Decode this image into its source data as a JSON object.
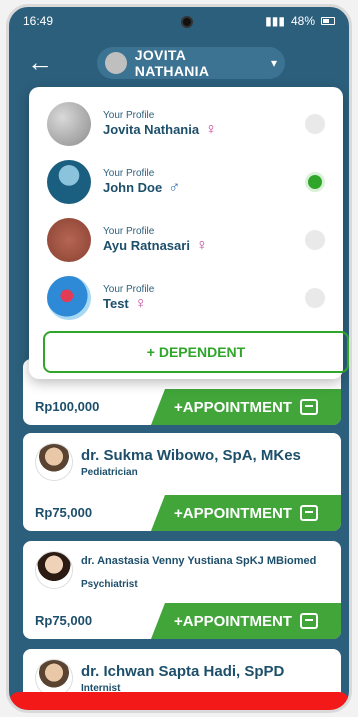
{
  "status": {
    "time": "16:49",
    "battery": "48%"
  },
  "header": {
    "selected_profile": "JOVITA NATHANIA",
    "icons": {
      "back": "arrow-left-icon",
      "caret": "chevron-down-icon"
    }
  },
  "dropdown": {
    "options": [
      {
        "caption": "Your Profile",
        "name": "Jovita Nathania",
        "gender": "♀",
        "selected": false
      },
      {
        "caption": "Your Profile",
        "name": "John Doe",
        "gender": "♂",
        "selected": true
      },
      {
        "caption": "Your Profile",
        "name": "Ayu Ratnasari",
        "gender": "♀",
        "selected": false
      },
      {
        "caption": "Your Profile",
        "name": "Test",
        "gender": "♀",
        "selected": false
      }
    ],
    "dependent_label": "+ DEPENDENT"
  },
  "list": {
    "cards": [
      {
        "price": "Rp100,000",
        "action": "+APPOINTMENT"
      },
      {
        "doctor": "dr. Sukma Wibowo, SpA, MKes",
        "specialty": "Pediatrician",
        "price": "Rp75,000",
        "action": "+APPOINTMENT"
      },
      {
        "doctor": "dr. Anastasia Venny Yustiana SpKJ MBiomed",
        "specialty": "Psychiatrist",
        "price": "Rp75,000",
        "action": "+APPOINTMENT"
      },
      {
        "doctor": "dr. Ichwan Sapta Hadi, SpPD",
        "specialty": "Internist"
      }
    ]
  },
  "colors": {
    "bg": "#2c5f7c",
    "green": "#41a53a",
    "red": "#f41919"
  }
}
